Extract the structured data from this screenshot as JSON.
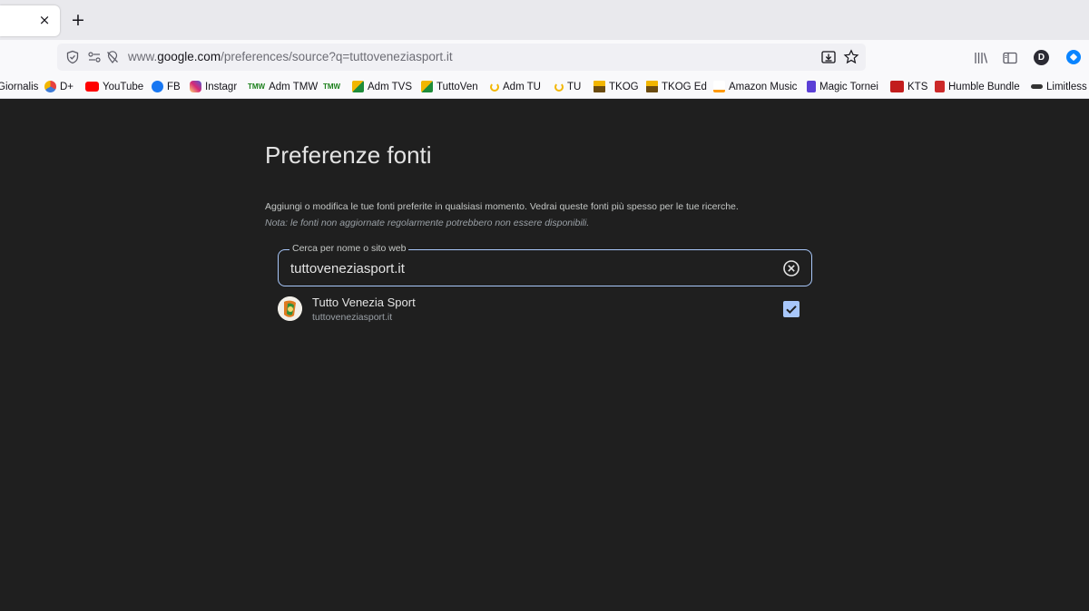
{
  "browser": {
    "tab_close": "×",
    "new_tab": "+",
    "url": {
      "prefix": "www.",
      "host": "google.com",
      "path": "/preferences/source?q=tuttoveneziasport.it"
    },
    "profile_initial": "D"
  },
  "bookmarks": [
    {
      "label": "Giornalis",
      "icon": "none"
    },
    {
      "label": "D+",
      "icon": "dplus-icon",
      "color": "#3e7bd6"
    },
    {
      "label": "YouTube",
      "icon": "youtube-icon",
      "color": "#ff0000"
    },
    {
      "label": "FB",
      "icon": "facebook-icon",
      "color": "#1877f2"
    },
    {
      "label": "Instagr",
      "icon": "instagram-icon",
      "color": "#d62976"
    },
    {
      "label": "Adm TMW",
      "icon": "tmw-icon",
      "badge": "TMW",
      "color": "#1a7f1a"
    },
    {
      "label": "",
      "icon": "tmw-icon",
      "badge": "TMW",
      "color": "#1a7f1a"
    },
    {
      "label": "Adm TVS",
      "icon": "tuttoven-icon",
      "color": "#1e8c3a"
    },
    {
      "label": "TuttoVen",
      "icon": "tuttoven-icon",
      "color": "#1e8c3a"
    },
    {
      "label": "Adm TU",
      "icon": "tu-icon",
      "color": "#f2b600"
    },
    {
      "label": "TU",
      "icon": "tu-icon",
      "color": "#f2b600"
    },
    {
      "label": "TKOG",
      "icon": "crown-icon",
      "color": "#6b4b10"
    },
    {
      "label": "TKOG Ed",
      "icon": "crown-icon",
      "color": "#6b4b10"
    },
    {
      "label": "Amazon Music",
      "icon": "amazon-icon",
      "color": "#232f3e"
    },
    {
      "label": "Magic Tornei",
      "icon": "magic-icon",
      "color": "#5b3fd6"
    },
    {
      "label": "KTS",
      "icon": "kts-icon",
      "color": "#c21d1d"
    },
    {
      "label": "Humble Bundle",
      "icon": "humble-icon",
      "color": "#cc2929"
    },
    {
      "label": "Limitless",
      "icon": "limitless-icon",
      "color": "#333333"
    }
  ],
  "page": {
    "title": "Preferenze fonti",
    "description": "Aggiungi o modifica le tue fonti preferite in qualsiasi momento. Vedrai queste fonti più spesso per le tue ricerche.",
    "note": "Nota: le fonti non aggiornate regolarmente potrebbero non essere disponibili.",
    "search": {
      "label": "Cerca per nome o sito web",
      "value": "tuttoveneziasport.it"
    },
    "results": [
      {
        "name": "Tutto Venezia Sport",
        "url": "tuttoveneziasport.it",
        "checked": true
      }
    ]
  },
  "colors": {
    "page_bg": "#1f1f1f",
    "accent": "#a8c7fa",
    "text": "#e3e3e3"
  }
}
